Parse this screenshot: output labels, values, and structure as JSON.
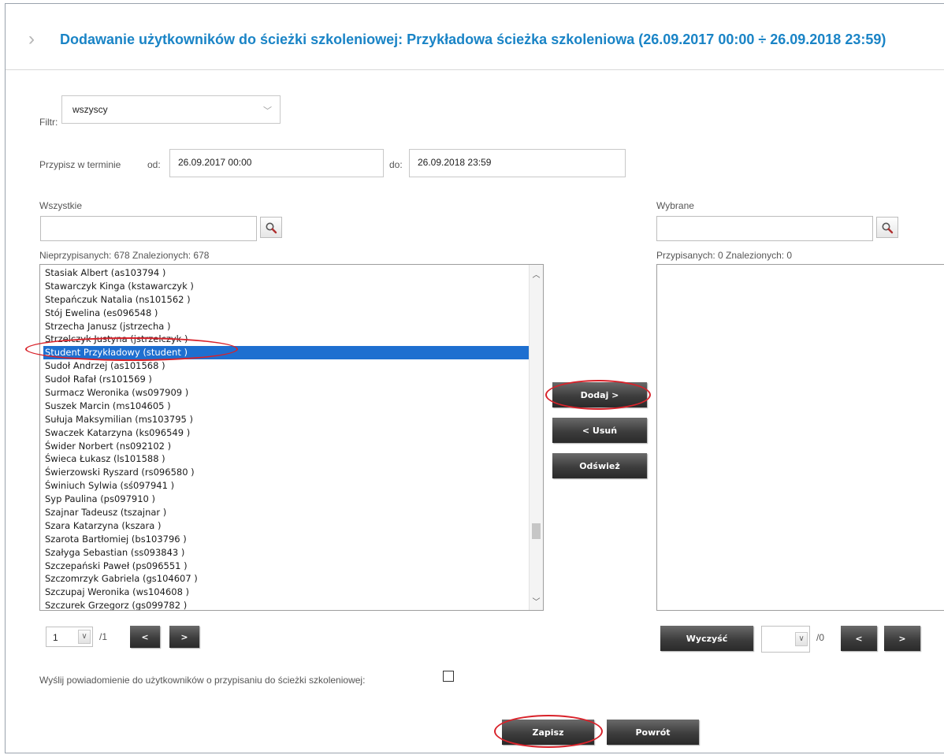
{
  "header": {
    "title": "Dodawanie użytkowników do ścieżki szkoleniowej: Przykładowa ścieżka szkoleniowa (26.09.2017 00:00 ÷ 26.09.2018 23:59)"
  },
  "filter": {
    "label": "Filtr:",
    "value": "wszyscy"
  },
  "assign": {
    "label": "Przypisz w terminie",
    "from_label": "od:",
    "from_value": "26.09.2017 00:00",
    "to_label": "do:",
    "to_value": "26.09.2018 23:59"
  },
  "left_panel": {
    "title": "Wszystkie",
    "search_value": "",
    "stats": "Nieprzypisanych: 678 Znalezionych: 678",
    "items": [
      "Stasiak Albert (as103794 )",
      "Stawarczyk Kinga (kstawarczyk )",
      "Stepańczuk Natalia (ns101562 )",
      "Stój Ewelina (es096548 )",
      "Strzecha Janusz (jstrzecha )",
      "Strzelczyk Justyna (jstrzelczyk )",
      "Student Przykładowy (student )",
      "Sudoł Andrzej (as101568 )",
      "Sudoł Rafał (rs101569 )",
      "Surmacz Weronika (ws097909 )",
      "Suszek Marcin (ms104605 )",
      "Sułuja Maksymilian (ms103795 )",
      "Swaczek Katarzyna (ks096549 )",
      "Świder Norbert (ns092102 )",
      "Świeca Łukasz (ls101588 )",
      "Świerzowski Ryszard (rs096580 )",
      "Świniuch Sylwia (sś097941 )",
      "Syp Paulina (ps097910 )",
      "Szajnar Tadeusz (tszajnar )",
      "Szara Katarzyna (kszara )",
      "Szarota Bartłomiej (bs103796 )",
      "Szałyga Sebastian (ss093843 )",
      "Szczepański Paweł (ps096551 )",
      "Szczomrzyk Gabriela (gs104607 )",
      "Szczupaj Weronika (ws104608 )",
      "Szczurek Grzegorz (gs099782 )"
    ],
    "selected_index": 6,
    "page_value": "1",
    "page_total": "/1"
  },
  "right_panel": {
    "title": "Wybrane",
    "search_value": "",
    "stats": "Przypisanych: 0 Znalezionych: 0",
    "page_value": "",
    "page_total": "/0"
  },
  "buttons": {
    "add": "Dodaj >",
    "remove": "< Usuń",
    "refresh": "Odśwież",
    "clear": "Wyczyść",
    "save": "Zapisz",
    "back": "Powrót",
    "prev": "<",
    "next": ">"
  },
  "notify": {
    "label": "Wyślij powiadomienie do użytkowników o przypisaniu do ścieżki szkoleniowej:",
    "checked": false
  },
  "colors": {
    "title": "#1a84c6",
    "selection": "#1e6fd0",
    "highlight_oval": "#d8222a"
  },
  "icons": {
    "search": "magnifier-icon",
    "title": "chevron-right-icon"
  }
}
